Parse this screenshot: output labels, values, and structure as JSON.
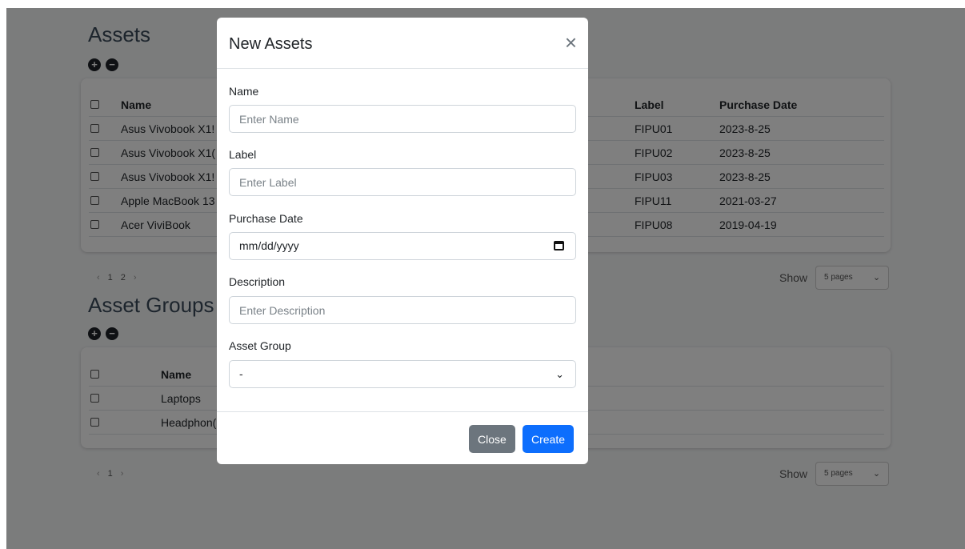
{
  "assets_section": {
    "title": "Assets",
    "columns": [
      "Name",
      "Label",
      "Purchase Date"
    ],
    "rows": [
      {
        "name": "Asus Vivobook X1!",
        "label": "FIPU01",
        "date": "2023-8-25"
      },
      {
        "name": "Asus Vivobook X1(",
        "label": "FIPU02",
        "date": "2023-8-25"
      },
      {
        "name": "Asus Vivobook X1!",
        "label": "FIPU03",
        "date": "2023-8-25"
      },
      {
        "name": "Apple MacBook 13",
        "label": "FIPU11",
        "date": "2021-03-27"
      },
      {
        "name": "Acer ViviBook",
        "label": "FIPU08",
        "date": "2019-04-19"
      }
    ],
    "pager": {
      "prev": "‹",
      "pages": [
        "1",
        "2"
      ],
      "next": "›"
    },
    "show_label": "Show",
    "show_value": "5 pages"
  },
  "groups_section": {
    "title": "Asset Groups",
    "columns": [
      "Name"
    ],
    "rows": [
      {
        "name": "Laptops"
      },
      {
        "name": "Headphon("
      }
    ],
    "pager": {
      "prev": "‹",
      "pages": [
        "1"
      ],
      "next": "›"
    },
    "show_label": "Show",
    "show_value": "5 pages"
  },
  "modal": {
    "title": "New Assets",
    "close_icon": "×",
    "fields": {
      "name": {
        "label": "Name",
        "placeholder": "Enter Name"
      },
      "label": {
        "label": "Label",
        "placeholder": "Enter Label"
      },
      "purchase_date": {
        "label": "Purchase Date",
        "value": "mm/dd/yyyy"
      },
      "description": {
        "label": "Description",
        "placeholder": "Enter Description"
      },
      "asset_group": {
        "label": "Asset Group",
        "value": "-"
      }
    },
    "close_button": "Close",
    "create_button": "Create"
  },
  "icons": {
    "add": "+",
    "remove": "−",
    "chevron": "⌄"
  },
  "colors": {
    "primary": "#0d6efd",
    "secondary": "#6c757d",
    "backdrop": "rgba(0,0,0,0.5)"
  }
}
